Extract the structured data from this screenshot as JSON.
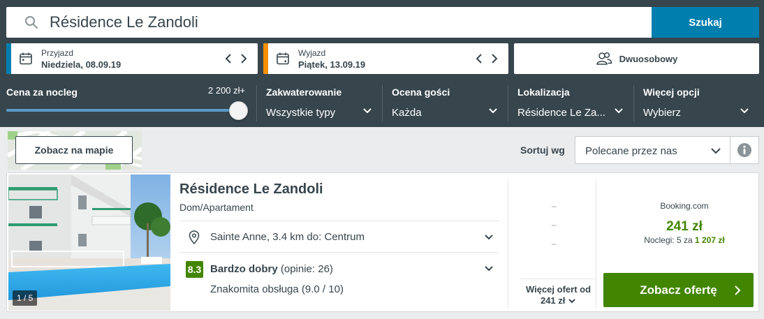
{
  "search": {
    "query": "Résidence Le Zandoli",
    "button_label": "Szukaj"
  },
  "dates": {
    "checkin_label": "Przyjazd",
    "checkin_value": "Niedziela, 08.09.19",
    "checkout_label": "Wyjazd",
    "checkout_value": "Piątek, 13.09.19",
    "checkin_accent": "#007faf",
    "checkout_accent": "#f48f00"
  },
  "room": {
    "label": "Dwuosobowy"
  },
  "filters": {
    "price_label": "Cena za nocleg",
    "price_max": "2 200 zł+",
    "price_slider_fraction": 1.0,
    "accommodation_title": "Zakwaterowanie",
    "accommodation_value": "Wszystkie typy",
    "rating_title": "Ocena gości",
    "rating_value": "Każda",
    "location_title": "Lokalizacja",
    "location_value": "Résidence Le Za...",
    "more_title": "Więcej opcji",
    "more_value": "Wybierz"
  },
  "map": {
    "button_label": "Zobacz na mapie"
  },
  "sort": {
    "label": "Sortuj wg",
    "selected": "Polecane przez nas"
  },
  "hotel": {
    "name": "Résidence Le Zandoli",
    "type": "Dom/Apartament",
    "photo_counter": "1 / 5",
    "location": "Sainte Anne, 3.4 km do: Centrum",
    "rating_score": "8.3",
    "rating_word": "Bardzo dobry",
    "rating_count": "(opinie: 26)",
    "service": "Znakomita obsługa (9.0 / 10)"
  },
  "offers": {
    "placeholders": [
      "–",
      "–",
      "–"
    ],
    "more_label": "Więcej ofert od",
    "more_price": "241 zł",
    "provider": "Booking.com",
    "price": "241 zł",
    "nights_prefix": "Noclegi: 5 za",
    "nights_total": "1 207 zł",
    "cta_label": "Zobacz ofertę"
  },
  "colors": {
    "header_bg": "#37454d",
    "primary_blue": "#007faf",
    "green": "#428500"
  }
}
